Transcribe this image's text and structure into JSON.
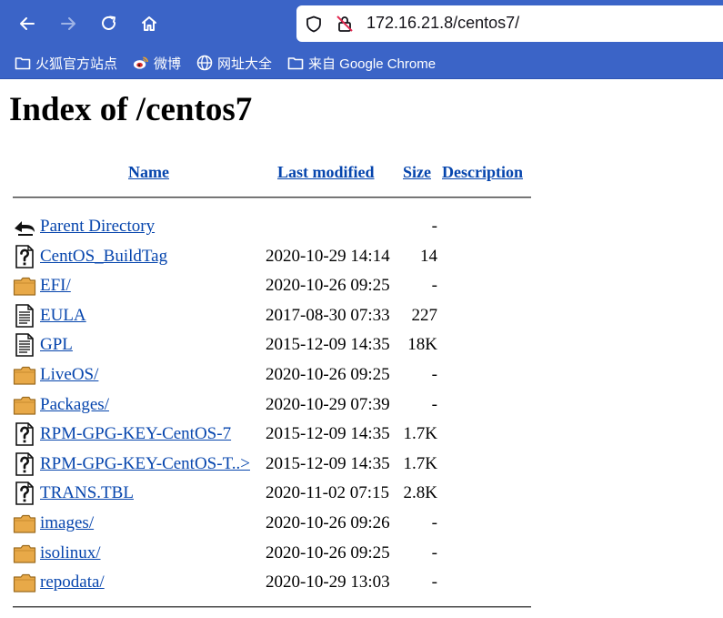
{
  "browser": {
    "url": "172.16.21.8/centos7/",
    "bookmarks": [
      {
        "label": "火狐官方站点",
        "icon": "folder-icon"
      },
      {
        "label": "微博",
        "icon": "weibo-icon"
      },
      {
        "label": "网址大全",
        "icon": "globe-icon"
      },
      {
        "label": "来自 Google Chrome",
        "icon": "folder-icon"
      }
    ],
    "colors": {
      "toolbar": "#3b64c7",
      "urlbar": "#ffffff"
    }
  },
  "page": {
    "title": "Index of /centos7",
    "columns": {
      "name": "Name",
      "modified": "Last modified",
      "size": "Size",
      "description": "Description"
    },
    "rows": [
      {
        "icon": "back-icon",
        "name": "Parent Directory",
        "modified": "",
        "size": "-"
      },
      {
        "icon": "unknown-file-icon",
        "name": "CentOS_BuildTag",
        "modified": "2020-10-29 14:14",
        "size": "14"
      },
      {
        "icon": "folder-icon",
        "name": "EFI/",
        "modified": "2020-10-26 09:25",
        "size": "-"
      },
      {
        "icon": "text-file-icon",
        "name": "EULA",
        "modified": "2017-08-30 07:33",
        "size": "227"
      },
      {
        "icon": "text-file-icon",
        "name": "GPL",
        "modified": "2015-12-09 14:35",
        "size": "18K"
      },
      {
        "icon": "folder-icon",
        "name": "LiveOS/",
        "modified": "2020-10-26 09:25",
        "size": "-"
      },
      {
        "icon": "folder-icon",
        "name": "Packages/",
        "modified": "2020-10-29 07:39",
        "size": "-"
      },
      {
        "icon": "unknown-file-icon",
        "name": "RPM-GPG-KEY-CentOS-7",
        "modified": "2015-12-09 14:35",
        "size": "1.7K"
      },
      {
        "icon": "unknown-file-icon",
        "name": "RPM-GPG-KEY-CentOS-T..>",
        "modified": "2015-12-09 14:35",
        "size": "1.7K"
      },
      {
        "icon": "unknown-file-icon",
        "name": "TRANS.TBL",
        "modified": "2020-11-02 07:15",
        "size": "2.8K"
      },
      {
        "icon": "folder-icon",
        "name": "images/",
        "modified": "2020-10-26 09:26",
        "size": "-"
      },
      {
        "icon": "folder-icon",
        "name": "isolinux/",
        "modified": "2020-10-26 09:25",
        "size": "-"
      },
      {
        "icon": "folder-icon",
        "name": "repodata/",
        "modified": "2020-10-29 13:03",
        "size": "-"
      }
    ],
    "colors": {
      "link": "#0645ad",
      "folder": "#e8a948"
    }
  }
}
